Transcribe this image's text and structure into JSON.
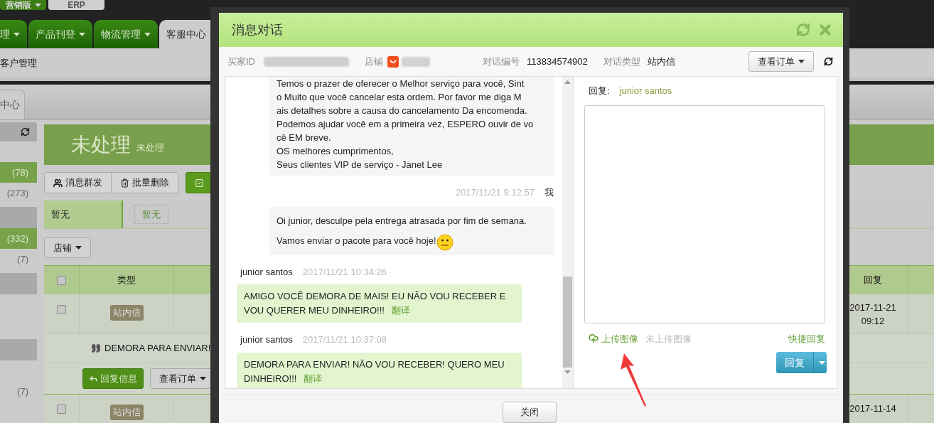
{
  "edition_tabs": [
    {
      "label": "营销版",
      "selected": true
    },
    {
      "label": "ERP",
      "selected": false
    }
  ],
  "nav_tabs": [
    {
      "label": "理",
      "selected": false
    },
    {
      "label": "产品刊登",
      "selected": false
    },
    {
      "label": "物流管理",
      "selected": false
    },
    {
      "label": "客服中心",
      "selected": true
    }
  ],
  "sub_nav": {
    "label": "客户管理"
  },
  "page_tab": {
    "label": "中心"
  },
  "sidebar": {
    "items": [
      {
        "kind": "toolbar"
      },
      {
        "kind": "blank"
      },
      {
        "kind": "item",
        "count": "(78)",
        "selected": true
      },
      {
        "kind": "item",
        "count": "(273)",
        "selected": false
      },
      {
        "kind": "group"
      },
      {
        "kind": "item",
        "count": "(332)",
        "selected": true
      },
      {
        "kind": "item",
        "count": "(7)",
        "selected": false
      },
      {
        "kind": "group"
      },
      {
        "kind": "blank"
      },
      {
        "kind": "blank"
      },
      {
        "kind": "group"
      },
      {
        "kind": "blank"
      },
      {
        "kind": "item",
        "count": "(7)",
        "selected": false
      }
    ]
  },
  "header": {
    "title": "未处理",
    "subtitle": "未处理"
  },
  "toolbar": [
    {
      "kind": "users",
      "label": "消息群发"
    },
    {
      "kind": "trash",
      "label": "批量删除"
    },
    {
      "kind": "check"
    }
  ],
  "filter": {
    "label": "暂无",
    "tag": "暂无"
  },
  "store_button": "店铺",
  "table": {
    "columns": [
      {
        "kind": "checkbox",
        "checked": false
      },
      {
        "label": "类型"
      },
      {
        "label": "回复"
      }
    ],
    "rows": [
      {
        "checked": false,
        "type": "站内信",
        "reply_time": "2017-11-21 09:12",
        "message": "DEMORA PARA ENVIAR!",
        "actions": [
          "回复信息",
          "查看订单"
        ]
      },
      {
        "checked": false,
        "type": "站内信",
        "reply_time": "2017-11-14"
      }
    ]
  },
  "dialog": {
    "title": "消息对话",
    "info": {
      "buyer_id_label": "买家ID",
      "store_label": "店铺",
      "conversation_no_label": "对话编号",
      "conversation_no": "113834574902",
      "type_label": "对话类型",
      "type": "站内信",
      "order_button": "查看订单"
    },
    "messages": [
      {
        "kind": "mine",
        "lines": [
          "Temos o prazer de oferecer o Melhor serviço para você, Sint",
          "o Muito que você cancelar esta ordem. Por favor me diga M",
          "ais detalhes sobre a causa do cancelamento Da encomenda.",
          "Podemos ajudar você em a primeira vez, ESPERO ouvir de vo",
          "cê EM breve.",
          "OS melhores cumprimentos,",
          "Seus clientes VIP de serviço - Janet Lee"
        ]
      },
      {
        "kind": "mine",
        "time": "2017/11/21 9:12:57",
        "sender": "我",
        "lines": [
          "Oi junior, desculpe pela entrega atrasada por fim de semana.",
          "Vamos enviar o pacote para você hoje!"
        ],
        "emoji": true
      },
      {
        "kind": "buyer",
        "sender": "junior santos",
        "time": "2017/11/21 10:34:26",
        "text": "AMIGO VOCÊ DEMORA DE MAIS! EU NÃO VOU RECEBER E VOU QUERER MEU DINHEIRO!!!",
        "translate": "翻译"
      },
      {
        "kind": "buyer",
        "sender": "junior santos",
        "time": "2017/11/21 10:37:08",
        "text": "DEMORA PARA ENVIAR! NÃO VOU RECEBER! QUERO MEU DINHEIRO!!!",
        "translate": "翻译"
      }
    ],
    "reply": {
      "label": "回复:",
      "recipient": "junior santos",
      "upload": "上传图像",
      "upload_status": "未上传图像",
      "quick_reply": "快捷回复",
      "send_button": "回复"
    },
    "close_button": "关闭"
  }
}
